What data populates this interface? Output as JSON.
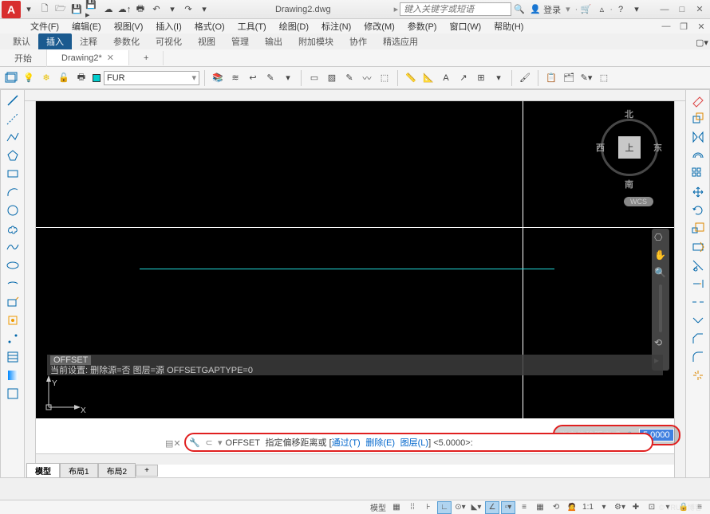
{
  "title": {
    "filename": "Drawing2.dwg",
    "search_placeholder": "键入关键字或短语",
    "login": "登录"
  },
  "window_controls": {
    "min_outer": "—",
    "max_outer": "□",
    "close_outer": "✕",
    "min_inner": "—",
    "restore_inner": "❐",
    "close_inner": "✕"
  },
  "menus": [
    "文件(F)",
    "编辑(E)",
    "视图(V)",
    "插入(I)",
    "格式(O)",
    "工具(T)",
    "绘图(D)",
    "标注(N)",
    "修改(M)",
    "参数(P)",
    "窗口(W)",
    "帮助(H)"
  ],
  "ribbon_tabs": [
    "默认",
    "插入",
    "注释",
    "参数化",
    "可视化",
    "视图",
    "管理",
    "输出",
    "附加模块",
    "协作",
    "精选应用"
  ],
  "ribbon_active": 1,
  "doc_tabs": [
    {
      "label": "开始",
      "closable": false,
      "active": false
    },
    {
      "label": "Drawing2*",
      "closable": true,
      "active": true
    }
  ],
  "add_tab": "+",
  "layer": {
    "current": "FUR"
  },
  "viewcube": {
    "top": "上",
    "n": "北",
    "s": "南",
    "e": "东",
    "w": "西",
    "wcs": "WCS"
  },
  "ucs": {
    "x": "X",
    "y": "Y"
  },
  "dynamic_input": {
    "label": "指定偏移距离或",
    "value": "5.0000"
  },
  "cmd_history": {
    "tag": "OFFSET",
    "line": "当前设置: 删除源=否  图层=源  OFFSETGAPTYPE=0"
  },
  "cmdline": {
    "prefix": "OFFSET",
    "body": "指定偏移距离或 [",
    "opt1": "通过(T)",
    "opt2": "删除(E)",
    "opt3": "图层(L)",
    "tail": "] <5.0000>:"
  },
  "model_tabs": [
    "模型",
    "布局1",
    "布局2",
    "+"
  ],
  "status": {
    "model": "模型",
    "scale": "1:1",
    "zoom": "—"
  },
  "watermark": "© TRUE 博客"
}
